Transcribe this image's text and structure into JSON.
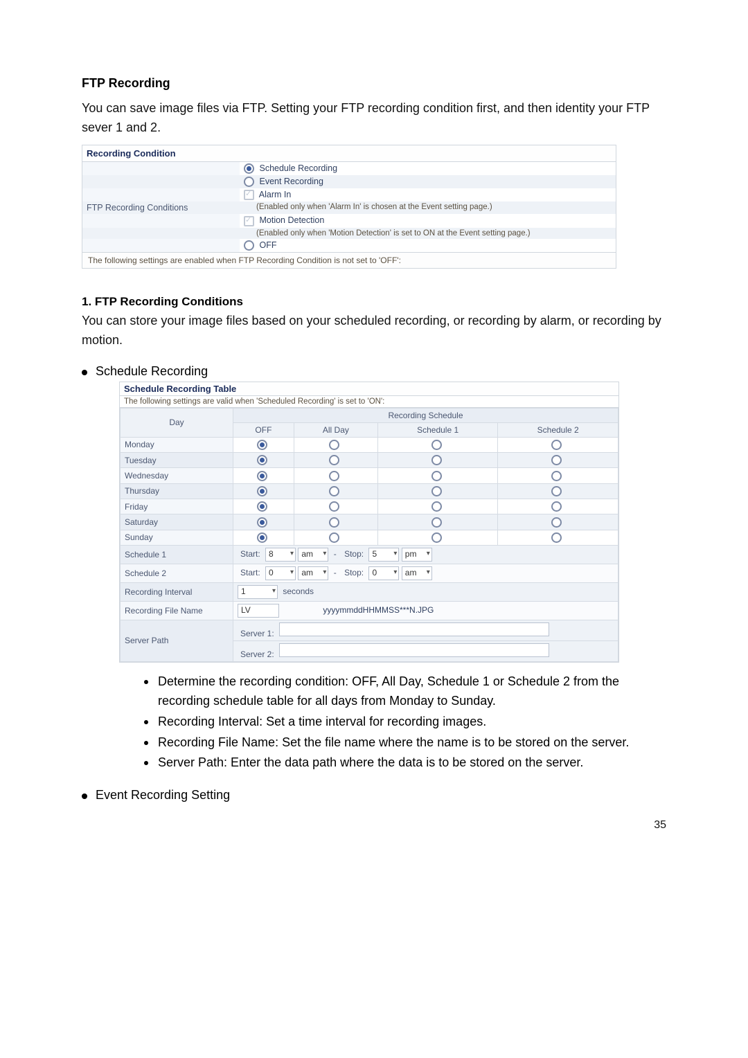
{
  "page_title": "FTP Recording",
  "intro": "You can save image files via FTP. Setting your FTP recording condition first, and then identity your FTP sever 1 and 2.",
  "panel1": {
    "header": "Recording Condition",
    "left_label": "FTP Recording Conditions",
    "options": {
      "schedule_label": "Schedule Recording",
      "event_label": "Event Recording",
      "alarm_label": "Alarm In",
      "alarm_note": "(Enabled only when 'Alarm In' is chosen at the Event setting page.)",
      "motion_label": "Motion Detection",
      "motion_note": "(Enabled only when 'Motion Detection' is set to ON at the Event setting page.)",
      "off_label": "OFF"
    },
    "footer_note": "The following settings are enabled when FTP Recording Condition is not set to 'OFF':"
  },
  "section1_heading": "1.  FTP Recording Conditions",
  "section1_text": "You can store your image files based on your scheduled recording, or recording by alarm, or recording by motion.",
  "schedule_bullet": "Schedule Recording",
  "panel2": {
    "header": "Schedule Recording Table",
    "note": "The following settings are valid when 'Scheduled Recording' is set to 'ON':",
    "day_header": "Day",
    "rec_sched_header": "Recording Schedule",
    "cols": {
      "off": "OFF",
      "allday": "All Day",
      "s1": "Schedule 1",
      "s2": "Schedule 2"
    },
    "days": [
      "Monday",
      "Tuesday",
      "Wednesday",
      "Thursday",
      "Friday",
      "Saturday",
      "Sunday"
    ],
    "sched1_label": "Schedule 1",
    "sched2_label": "Schedule 2",
    "start_label": "Start:",
    "stop_label": "Stop:",
    "s1_start_hour": "8",
    "s1_start_ampm": "am",
    "s1_stop_hour": "5",
    "s1_stop_ampm": "pm",
    "s2_start_hour": "0",
    "s2_start_ampm": "am",
    "s2_stop_hour": "0",
    "s2_stop_ampm": "am",
    "rec_interval_label": "Recording Interval",
    "rec_interval_val": "1",
    "seconds_label": "seconds",
    "rec_file_label": "Recording File Name",
    "rec_file_prefix": "LV",
    "rec_file_suffix": "yyyymmddHHMMSS***N.JPG",
    "server_path_label": "Server Path",
    "server1_label": "Server 1:",
    "server2_label": "Server 2:"
  },
  "sub_bullets": {
    "b1": "Determine the recording condition: OFF, All Day, Schedule 1 or Schedule 2 from the recording schedule table for all days from Monday to Sunday.",
    "b2": "Recording Interval: Set a time interval for recording images.",
    "b3": "Recording File Name: Set the file name where the name is to be stored on the server.",
    "b4": "Server Path: Enter the data path where the data is to be stored on the server."
  },
  "event_bullet": "Event Recording Setting",
  "page_number": "35"
}
